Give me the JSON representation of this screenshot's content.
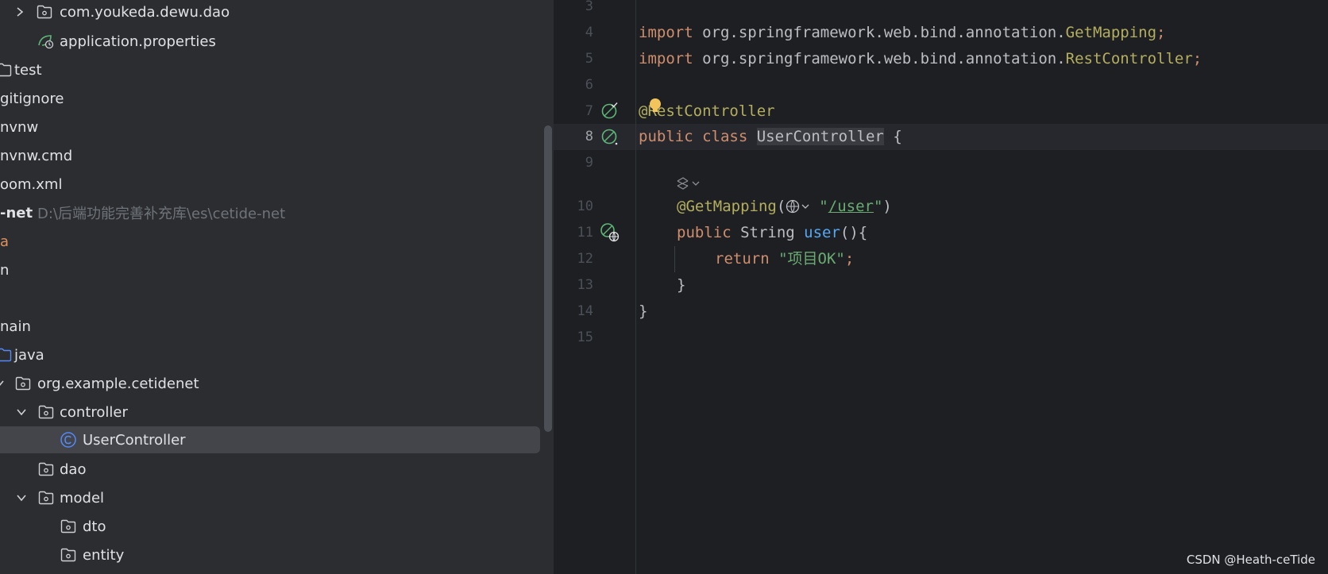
{
  "project_tree": {
    "rows": [
      {
        "label": "com.youkeda.dewu.dao"
      },
      {
        "label": "application.properties"
      },
      {
        "label": "test"
      },
      {
        "label": "gitignore"
      },
      {
        "label": "nvnw"
      },
      {
        "label": "nvnw.cmd"
      },
      {
        "label": "oom.xml"
      },
      {
        "label": "-net",
        "path": "D:\\后端功能完善补充库\\es\\cetide-net"
      },
      {
        "label": "a"
      },
      {
        "label": "n"
      },
      {
        "label": "nain"
      },
      {
        "label": "java"
      },
      {
        "label": "org.example.cetidenet"
      },
      {
        "label": "controller"
      },
      {
        "label": "UserController",
        "selected": true
      },
      {
        "label": "dao"
      },
      {
        "label": "model"
      },
      {
        "label": "dto"
      },
      {
        "label": "entity"
      }
    ]
  },
  "editor": {
    "line_numbers": [
      "3",
      "4",
      "5",
      "6",
      "7",
      "8",
      "9",
      "10",
      "11",
      "12",
      "13",
      "14",
      "15"
    ],
    "current_line": "8",
    "code": {
      "l4_import": "import",
      "l4_pkg": " org.springframework.web.bind.annotation.",
      "l4_cls": "GetMapping",
      "l4_semi": ";",
      "l5_import": "import",
      "l5_pkg": " org.springframework.web.bind.annotation.",
      "l5_cls": "RestController",
      "l5_semi": ";",
      "l7_ann": "@RestController",
      "l8_public": "public",
      "l8_class": " class ",
      "l8_name": "UserController",
      "l8_brace": " {",
      "l10_ann": "@GetMapping",
      "l10_open": "(",
      "l10_str_open": "\"",
      "l10_url": "/user",
      "l10_str_close": "\"",
      "l10_close": ")",
      "l11_public": "public",
      "l11_type": " String ",
      "l11_fn": "user",
      "l11_rest": "(){",
      "l12_return": "return",
      "l12_str": " \"项目OK\"",
      "l12_semi": ";",
      "l13": "}",
      "l14": "}"
    }
  },
  "watermark": "CSDN @Heath-ceTide",
  "colors": {
    "keyword": "#cf8e6d",
    "annotation": "#b3ae60",
    "string": "#6aab73",
    "function": "#56a8f5",
    "gutter_icon": "#5fb878",
    "folder_icon": "#ced0d6",
    "class_icon": "#548af7"
  }
}
